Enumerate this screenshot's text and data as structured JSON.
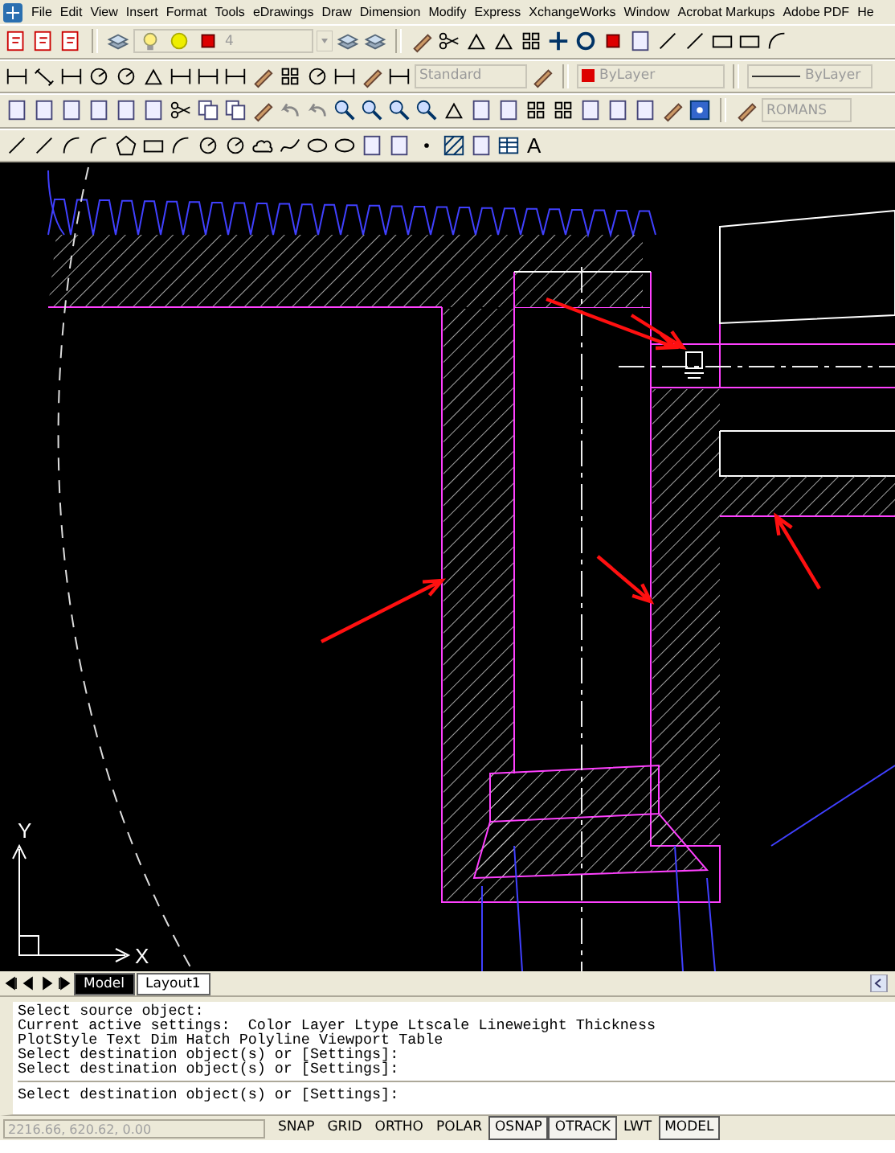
{
  "menu_bar": {
    "items": [
      "File",
      "Edit",
      "View",
      "Insert",
      "Format",
      "Tools",
      "eDrawings",
      "Draw",
      "Dimension",
      "Modify",
      "Express",
      "XchangeWorks",
      "Window",
      "Acrobat Markups",
      "Adobe PDF",
      "He"
    ]
  },
  "toolbars": {
    "layer_name": "4",
    "dim_style": "Standard",
    "color_name": "ByLayer",
    "linetype": "ByLayer",
    "text_style": "ROMANS",
    "mtext_glyph": "A"
  },
  "drawing": {
    "ucs_y": "Y",
    "ucs_x": "X"
  },
  "layout_tabs": [
    {
      "label": "Model",
      "selected": true
    },
    {
      "label": "Layout1",
      "selected": false
    }
  ],
  "command_history": [
    "Select source object:",
    "Current active settings:  Color Layer Ltype Ltscale Lineweight Thickness",
    "PlotStyle Text Dim Hatch Polyline Viewport Table",
    "Select destination object(s) or [Settings]:",
    "Select destination object(s) or [Settings]:"
  ],
  "command_prompt": "Select destination object(s) or [Settings]:",
  "status_bar": {
    "coordinates": "2216.66, 620.62, 0.00",
    "toggles": [
      {
        "label": "SNAP",
        "on": false
      },
      {
        "label": "GRID",
        "on": false
      },
      {
        "label": "ORTHO",
        "on": false
      },
      {
        "label": "POLAR",
        "on": false
      },
      {
        "label": "OSNAP",
        "on": true
      },
      {
        "label": "OTRACK",
        "on": true
      },
      {
        "label": "LWT",
        "on": false
      },
      {
        "label": "MODEL",
        "on": true
      }
    ]
  }
}
